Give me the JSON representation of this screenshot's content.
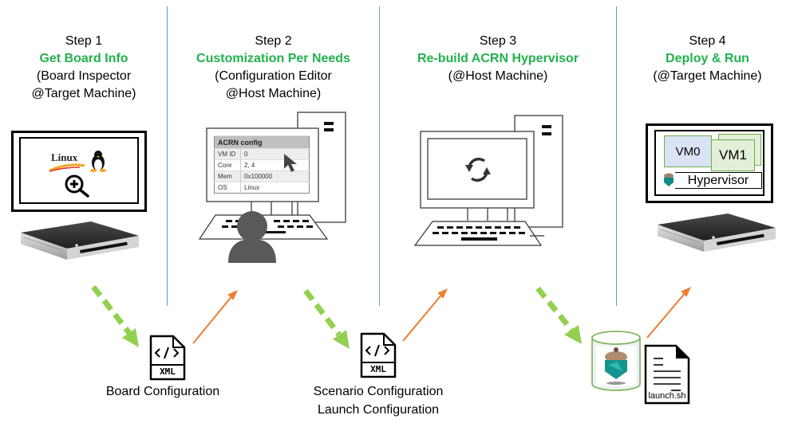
{
  "steps": [
    {
      "number": "Step 1",
      "title": "Get Board Info",
      "subtitle_lines": [
        "(Board Inspector",
        "@Target Machine)"
      ]
    },
    {
      "number": "Step 2",
      "title": "Customization Per Needs",
      "subtitle_lines": [
        "(Configuration Editor",
        "@Host Machine)"
      ]
    },
    {
      "number": "Step 3",
      "title": "Re-build ACRN Hypervisor",
      "subtitle_lines": [
        "(@Host Machine)"
      ]
    },
    {
      "number": "Step 4",
      "title": "Deploy & Run",
      "subtitle_lines": [
        "(@Target Machine)"
      ]
    }
  ],
  "step1_screen": {
    "logo_text": "Linux"
  },
  "step2_config": {
    "title": "ACRN config",
    "rows": [
      {
        "key": "VM ID",
        "value": "0"
      },
      {
        "key": "Core",
        "value": "2, 4"
      },
      {
        "key": "Mem",
        "value": "0x100000"
      },
      {
        "key": "OS",
        "value": "Linux"
      }
    ]
  },
  "step4_screen": {
    "vm0": "VM0",
    "vm1": "VM1",
    "hypervisor": "Hypervisor"
  },
  "artifacts": {
    "board": {
      "file_label": "XML",
      "caption_lines": [
        "Board Configuration"
      ]
    },
    "scenario": {
      "file_label": "XML",
      "caption_lines": [
        "Scenario Configuration",
        "Launch Configuration"
      ]
    },
    "script": {
      "file_label": "launch.sh"
    }
  },
  "colors": {
    "title_green": "#22b14c",
    "dashed_arrow": "#92d050",
    "solid_arrow": "#ed7d31",
    "divider": "#5b9bd5"
  }
}
